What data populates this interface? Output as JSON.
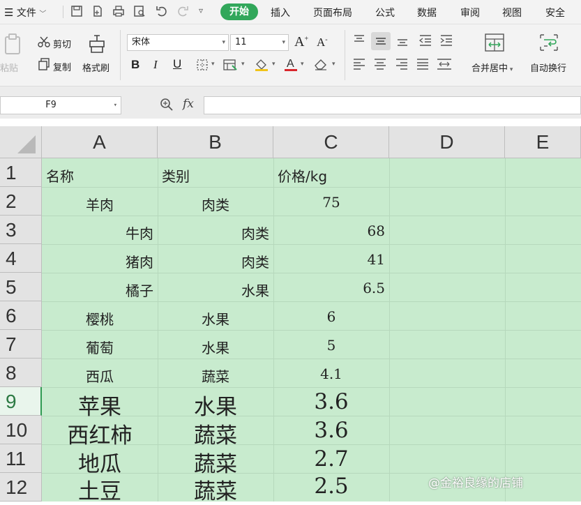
{
  "menu": {
    "file": "文件",
    "tabs": [
      "开始",
      "插入",
      "页面布局",
      "公式",
      "数据",
      "审阅",
      "视图",
      "安全"
    ]
  },
  "ribbon": {
    "paste": "粘贴",
    "cut": "剪切",
    "copy": "复制",
    "format_painter": "格式刷",
    "font_name": "宋体",
    "font_size": "11",
    "merge_center": "合并居中",
    "wrap_text": "自动换行"
  },
  "formula_bar": {
    "name_box": "F9",
    "fx": "fx",
    "formula": ""
  },
  "columns": [
    "A",
    "B",
    "C",
    "D",
    "E"
  ],
  "rows": [
    "1",
    "2",
    "3",
    "4",
    "5",
    "6",
    "7",
    "8",
    "9",
    "10",
    "11",
    "12"
  ],
  "active_row": "9",
  "cells": {
    "r1": [
      "名称",
      "类别",
      "价格/kg"
    ],
    "r2": [
      "羊肉",
      "肉类",
      "75"
    ],
    "r3": [
      "牛肉",
      "肉类",
      "68"
    ],
    "r4": [
      "猪肉",
      "肉类",
      "41"
    ],
    "r5": [
      "橘子",
      "水果",
      "6.5"
    ],
    "r6": [
      "樱桃",
      "水果",
      "6"
    ],
    "r7": [
      "葡萄",
      "水果",
      "5"
    ],
    "r8": [
      "西瓜",
      "蔬菜",
      "4.1"
    ],
    "r9": [
      "苹果",
      "水果",
      "3.6"
    ],
    "r10": [
      "西红柿",
      "蔬菜",
      "3.6"
    ],
    "r11": [
      "地瓜",
      "蔬菜",
      "2.7"
    ],
    "r12": [
      "土豆",
      "蔬菜",
      "2.5"
    ]
  },
  "watermark": "@金裕良缘的店铺",
  "colors": {
    "cell_fill": "#c8ebce",
    "accent_green": "#31a75a",
    "header_gray": "#e3e3e3"
  }
}
